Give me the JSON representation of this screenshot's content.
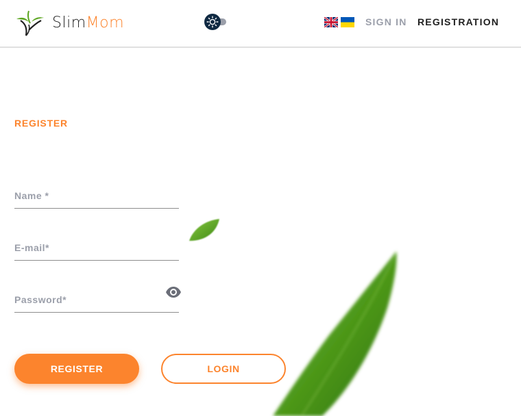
{
  "header": {
    "logo": {
      "slim": "Slim",
      "mom": "Mom"
    },
    "theme_toggle": {
      "icon": "sun-icon",
      "state": "light"
    },
    "languages": [
      {
        "code": "en",
        "icon": "uk-flag-icon"
      },
      {
        "code": "uk",
        "icon": "ukraine-flag-icon"
      }
    ],
    "nav": {
      "sign_in": "SIGN IN",
      "registration": "REGISTRATION"
    }
  },
  "form": {
    "title": "REGISTER",
    "name_placeholder": "Name *",
    "email_placeholder": "E-mail*",
    "password_placeholder": "Password*",
    "password_toggle_icon": "eye-icon",
    "register_button": "REGISTER",
    "login_button": "LOGIN"
  },
  "colors": {
    "accent": "#fc842d",
    "muted": "#9b9faa",
    "text": "#212121",
    "toggle_dark": "#102a43",
    "leaf_green": "#5aa51e"
  }
}
